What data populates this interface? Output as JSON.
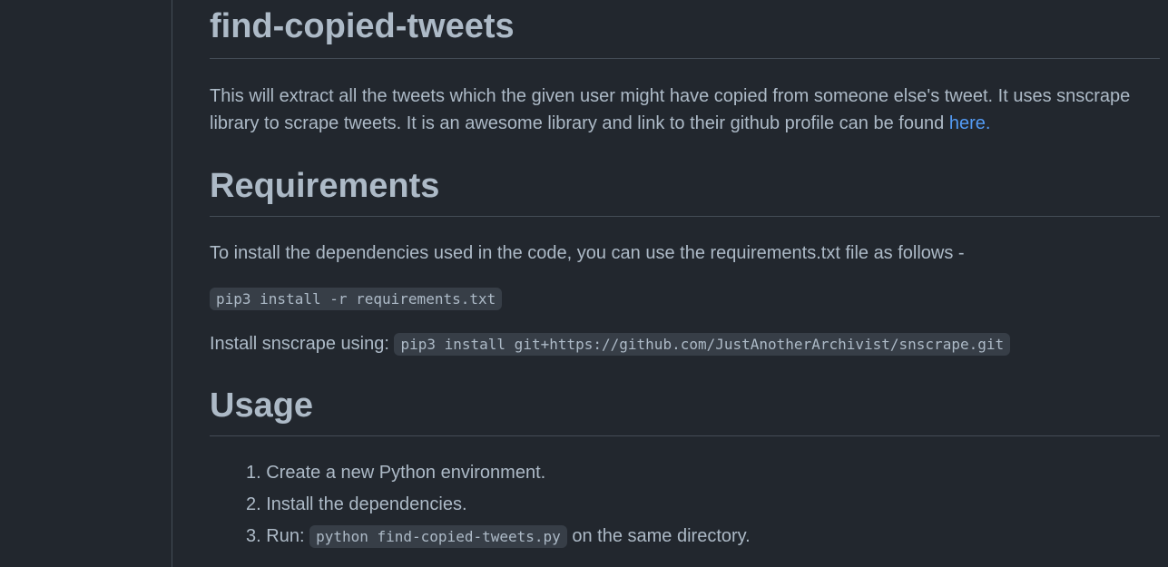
{
  "readme": {
    "title": "find-copied-tweets",
    "intro_text": "This will extract all the tweets which the given user might have copied from someone else's tweet. It uses snscrape library to scrape tweets. It is an awesome library and link to their github profile can be found",
    "intro_link": "here.",
    "requirements": {
      "heading": "Requirements",
      "text": "To install the dependencies used in the code, you can use the requirements.txt file as follows -",
      "code_install": "pip3 install -r requirements.txt",
      "snscrape_label": "Install snscrape using:",
      "snscrape_code": "pip3 install git+https://github.com/JustAnotherArchivist/snscrape.git"
    },
    "usage": {
      "heading": "Usage",
      "steps": [
        {
          "num": "1.",
          "text": "Create a new Python environment."
        },
        {
          "num": "2.",
          "text": "Install the dependencies."
        },
        {
          "num": "3.",
          "prefix": "Run:",
          "code": "python find-copied-tweets.py",
          "suffix": "on the same directory."
        }
      ]
    }
  }
}
